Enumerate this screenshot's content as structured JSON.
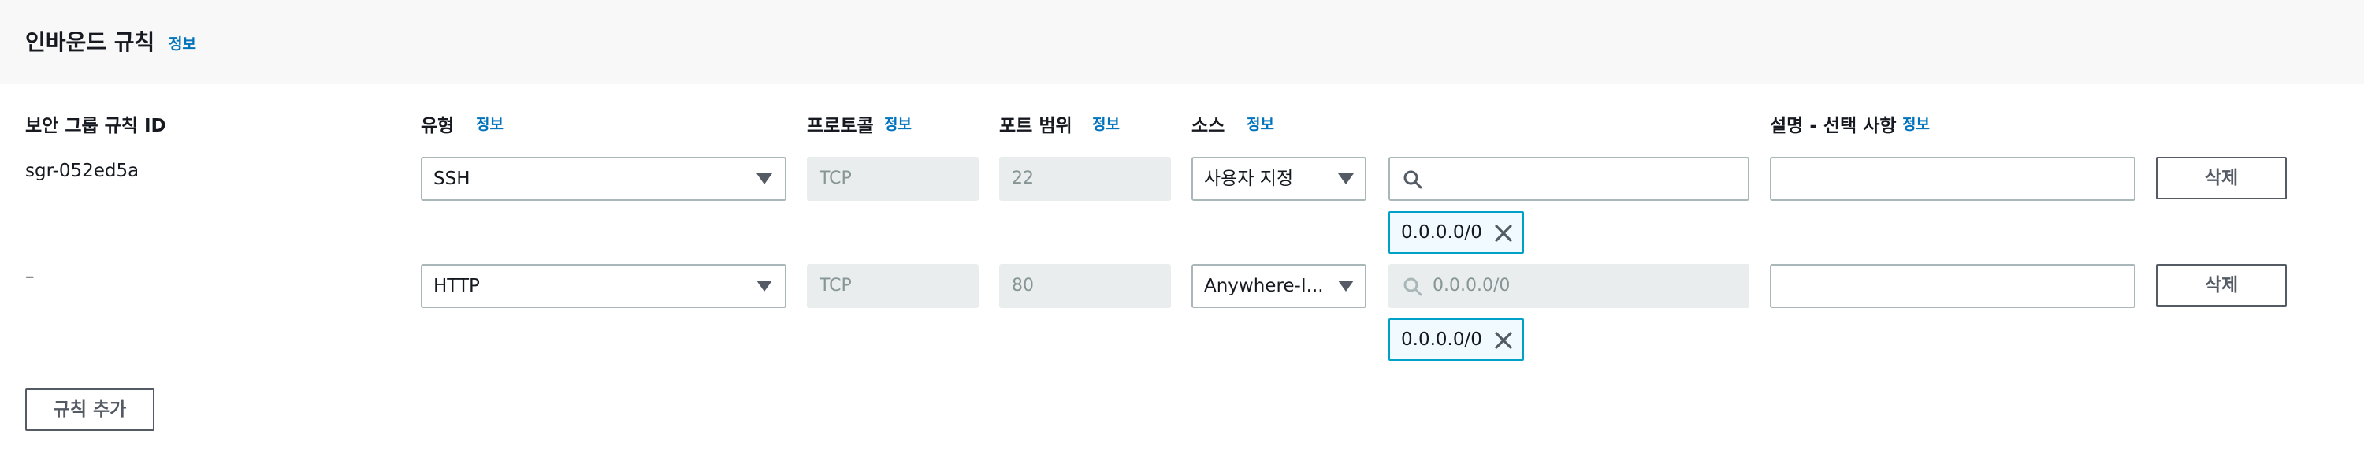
{
  "section": {
    "title": "인바운드 규칙",
    "info_link": "정보"
  },
  "columns": {
    "rule_id": "보안 그룹 규칙 ID",
    "type": "유형",
    "protocol": "프로토콜",
    "port_range": "포트 범위",
    "source": "소스",
    "description": "설명 - 선택 사항",
    "info_link": "정보"
  },
  "rules": [
    {
      "rule_id": "sgr-052ed5a",
      "type": "SSH",
      "protocol": "TCP",
      "port_range": "22",
      "source": "사용자 지정",
      "search_value": "",
      "search_placeholder": "",
      "token": "0.0.0.0/0",
      "description": "",
      "delete_label": "삭제"
    },
    {
      "rule_id": "–",
      "type": "HTTP",
      "protocol": "TCP",
      "port_range": "80",
      "source": "Anywhere-I...",
      "search_value": "",
      "search_placeholder": "0.0.0.0/0",
      "token": "0.0.0.0/0",
      "description": "",
      "delete_label": "삭제"
    }
  ],
  "add_rule_label": "규칙 추가",
  "icons": [
    "search-icon",
    "close-icon",
    "caret-down-icon"
  ],
  "colors": {
    "info_link": "#0073bb",
    "token_border": "#00a1c9",
    "token_bg": "#f1faff",
    "disabled_bg": "#eaeded"
  }
}
